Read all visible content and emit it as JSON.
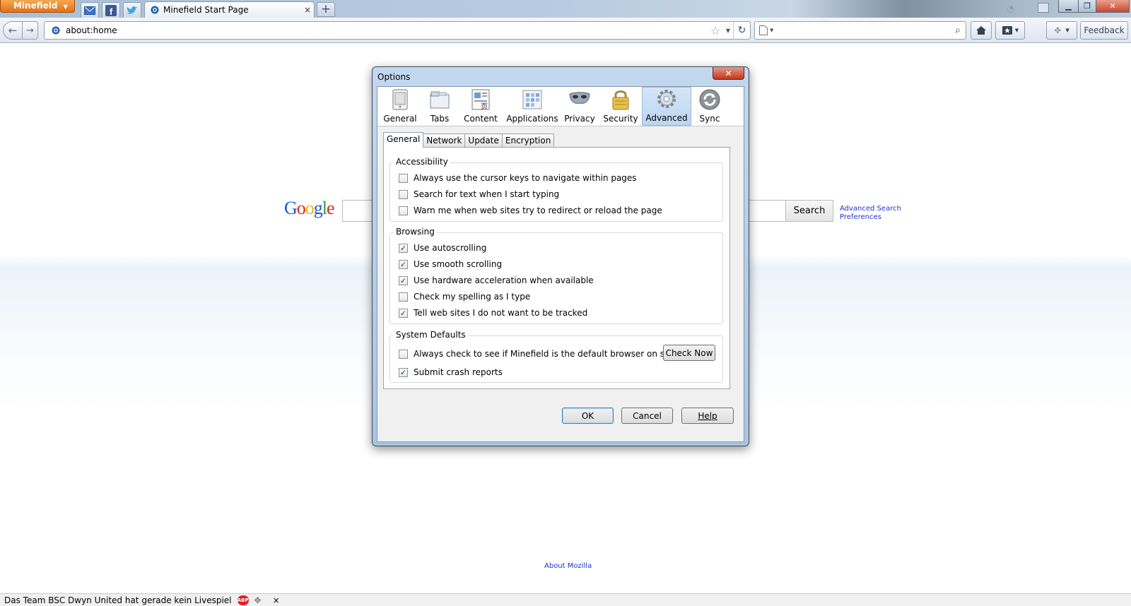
{
  "browser": {
    "app_button": "Minefield",
    "tab_title": "Minefield Start Page",
    "tab_close": "×",
    "new_tab": "+",
    "url": "about:home",
    "feedback": "Feedback"
  },
  "page": {
    "google_logo": [
      "G",
      "o",
      "o",
      "g",
      "l",
      "e"
    ],
    "google_colors": [
      "#1a56d4",
      "#d8281f",
      "#f2b40f",
      "#1a56d4",
      "#2a9b3c",
      "#d8281f"
    ],
    "search_button": "Search",
    "advanced_search": "Advanced Search",
    "preferences": "Preferences",
    "about_mozilla": "About Mozilla"
  },
  "statusbar": {
    "text": "Das Team BSC Dwyn United hat gerade kein Livespiel",
    "abp": "ABP",
    "close": "×"
  },
  "dialog": {
    "title": "Options",
    "close": "✕",
    "panes": [
      {
        "label": "General",
        "icon": "general-icon"
      },
      {
        "label": "Tabs",
        "icon": "tabs-icon"
      },
      {
        "label": "Content",
        "icon": "content-icon"
      },
      {
        "label": "Applications",
        "icon": "applications-icon"
      },
      {
        "label": "Privacy",
        "icon": "privacy-icon"
      },
      {
        "label": "Security",
        "icon": "security-icon"
      },
      {
        "label": "Advanced",
        "icon": "advanced-icon",
        "selected": true
      },
      {
        "label": "Sync",
        "icon": "sync-icon"
      }
    ],
    "subtabs": [
      "General",
      "Network",
      "Update",
      "Encryption"
    ],
    "active_subtab": "General",
    "groups": {
      "accessibility": {
        "caption": "Accessibility",
        "items": [
          {
            "label": "Always use the cursor keys to navigate within pages",
            "checked": false
          },
          {
            "label": "Search for text when I start typing",
            "checked": false
          },
          {
            "label": "Warn me when web sites try to redirect or reload the page",
            "checked": false
          }
        ]
      },
      "browsing": {
        "caption": "Browsing",
        "items": [
          {
            "label": "Use autoscrolling",
            "checked": true
          },
          {
            "label": "Use smooth scrolling",
            "checked": true
          },
          {
            "label": "Use hardware acceleration when available",
            "checked": true
          },
          {
            "label": "Check my spelling as I type",
            "checked": false
          },
          {
            "label": "Tell web sites I do not want to be tracked",
            "checked": true
          }
        ]
      },
      "system_defaults": {
        "caption": "System Defaults",
        "items": [
          {
            "label": "Always check to see if Minefield is the default browser on startup",
            "checked": false
          },
          {
            "label": "Submit crash reports",
            "checked": true
          }
        ],
        "check_now": "Check Now"
      }
    },
    "buttons": {
      "ok": "OK",
      "cancel": "Cancel",
      "help": "Help"
    }
  }
}
